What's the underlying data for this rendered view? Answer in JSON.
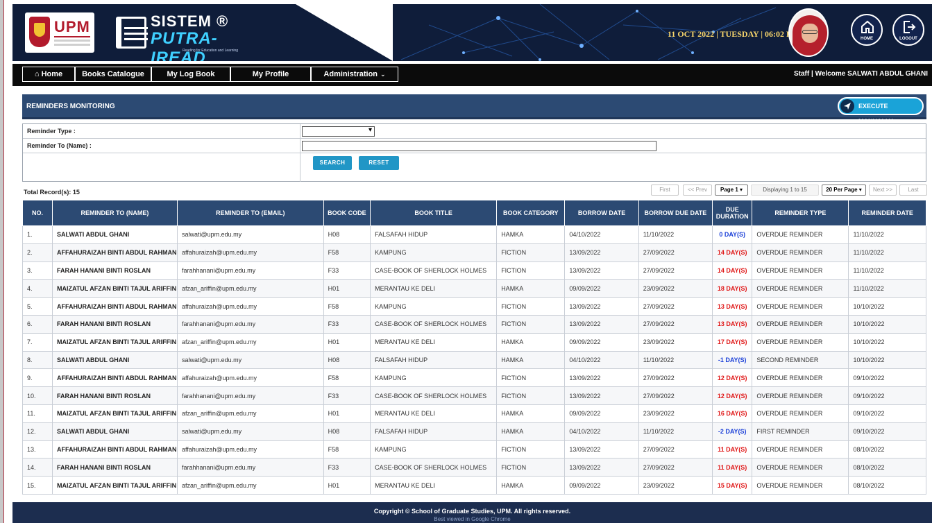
{
  "header": {
    "upm_logo_text": "UPM",
    "brand_line1": "SISTEM ®",
    "brand_line2": "PUTRA-IREAD",
    "brand_tagline": "Reading for Education and Learning",
    "datetime": "11 OCT 2022 | TUESDAY | 06:02 PM",
    "home_label": "HOME",
    "logout_label": "LOGOUT"
  },
  "nav": {
    "home": "Home",
    "books_catalogue": "Books Catalogue",
    "my_log_book": "My Log Book",
    "my_profile": "My Profile",
    "administration": "Administration",
    "welcome": "Staff | Welcome SALWATI ABDUL GHANI"
  },
  "panel": {
    "title": "REMINDERS MONITORING",
    "execute_label": "EXECUTE MANUALLY"
  },
  "filter": {
    "reminder_type_label": "Reminder Type :",
    "reminder_type_value": "",
    "reminder_to_label": "Reminder To (Name) :",
    "reminder_to_value": "",
    "search_label": "SEARCH",
    "reset_label": "RESET"
  },
  "pager": {
    "total": "Total Record(s): 15",
    "first": "First",
    "prev": "<< Prev",
    "page": "Page 1",
    "displaying": "Displaying 1 to 15",
    "per_page": "20 Per Page",
    "next": "Next >>",
    "last": "Last"
  },
  "table": {
    "columns": [
      "NO.",
      "REMINDER TO (NAME)",
      "REMINDER TO (EMAIL)",
      "BOOK CODE",
      "BOOK TITLE",
      "BOOK CATEGORY",
      "BORROW DATE",
      "BORROW DUE DATE",
      "DUE DURATION",
      "REMINDER TYPE",
      "REMINDER DATE"
    ],
    "rows": [
      [
        "1.",
        "SALWATI ABDUL GHANI",
        "salwati@upm.edu.my",
        "H08",
        "FALSAFAH HIDUP",
        "HAMKA",
        "04/10/2022",
        "11/10/2022",
        "0 DAY(S)",
        "OVERDUE REMINDER",
        "11/10/2022"
      ],
      [
        "2.",
        "AFFAHURAIZAH BINTI ABDUL RAHMAN",
        "affahuraizah@upm.edu.my",
        "F58",
        "KAMPUNG",
        "FICTION",
        "13/09/2022",
        "27/09/2022",
        "14 DAY(S)",
        "OVERDUE REMINDER",
        "11/10/2022"
      ],
      [
        "3.",
        "FARAH HANANI BINTI ROSLAN",
        "farahhanani@upm.edu.my",
        "F33",
        "CASE-BOOK OF SHERLOCK HOLMES",
        "FICTION",
        "13/09/2022",
        "27/09/2022",
        "14 DAY(S)",
        "OVERDUE REMINDER",
        "11/10/2022"
      ],
      [
        "4.",
        "MAIZATUL AFZAN BINTI TAJUL ARIFFIN",
        "afzan_ariffin@upm.edu.my",
        "H01",
        "MERANTAU KE DELI",
        "HAMKA",
        "09/09/2022",
        "23/09/2022",
        "18 DAY(S)",
        "OVERDUE REMINDER",
        "11/10/2022"
      ],
      [
        "5.",
        "AFFAHURAIZAH BINTI ABDUL RAHMAN",
        "affahuraizah@upm.edu.my",
        "F58",
        "KAMPUNG",
        "FICTION",
        "13/09/2022",
        "27/09/2022",
        "13 DAY(S)",
        "OVERDUE REMINDER",
        "10/10/2022"
      ],
      [
        "6.",
        "FARAH HANANI BINTI ROSLAN",
        "farahhanani@upm.edu.my",
        "F33",
        "CASE-BOOK OF SHERLOCK HOLMES",
        "FICTION",
        "13/09/2022",
        "27/09/2022",
        "13 DAY(S)",
        "OVERDUE REMINDER",
        "10/10/2022"
      ],
      [
        "7.",
        "MAIZATUL AFZAN BINTI TAJUL ARIFFIN",
        "afzan_ariffin@upm.edu.my",
        "H01",
        "MERANTAU KE DELI",
        "HAMKA",
        "09/09/2022",
        "23/09/2022",
        "17 DAY(S)",
        "OVERDUE REMINDER",
        "10/10/2022"
      ],
      [
        "8.",
        "SALWATI ABDUL GHANI",
        "salwati@upm.edu.my",
        "H08",
        "FALSAFAH HIDUP",
        "HAMKA",
        "04/10/2022",
        "11/10/2022",
        "-1 DAY(S)",
        "SECOND REMINDER",
        "10/10/2022"
      ],
      [
        "9.",
        "AFFAHURAIZAH BINTI ABDUL RAHMAN",
        "affahuraizah@upm.edu.my",
        "F58",
        "KAMPUNG",
        "FICTION",
        "13/09/2022",
        "27/09/2022",
        "12 DAY(S)",
        "OVERDUE REMINDER",
        "09/10/2022"
      ],
      [
        "10.",
        "FARAH HANANI BINTI ROSLAN",
        "farahhanani@upm.edu.my",
        "F33",
        "CASE-BOOK OF SHERLOCK HOLMES",
        "FICTION",
        "13/09/2022",
        "27/09/2022",
        "12 DAY(S)",
        "OVERDUE REMINDER",
        "09/10/2022"
      ],
      [
        "11.",
        "MAIZATUL AFZAN BINTI TAJUL ARIFFIN",
        "afzan_ariffin@upm.edu.my",
        "H01",
        "MERANTAU KE DELI",
        "HAMKA",
        "09/09/2022",
        "23/09/2022",
        "16 DAY(S)",
        "OVERDUE REMINDER",
        "09/10/2022"
      ],
      [
        "12.",
        "SALWATI ABDUL GHANI",
        "salwati@upm.edu.my",
        "H08",
        "FALSAFAH HIDUP",
        "HAMKA",
        "04/10/2022",
        "11/10/2022",
        "-2 DAY(S)",
        "FIRST REMINDER",
        "09/10/2022"
      ],
      [
        "13.",
        "AFFAHURAIZAH BINTI ABDUL RAHMAN",
        "affahuraizah@upm.edu.my",
        "F58",
        "KAMPUNG",
        "FICTION",
        "13/09/2022",
        "27/09/2022",
        "11 DAY(S)",
        "OVERDUE REMINDER",
        "08/10/2022"
      ],
      [
        "14.",
        "FARAH HANANI BINTI ROSLAN",
        "farahhanani@upm.edu.my",
        "F33",
        "CASE-BOOK OF SHERLOCK HOLMES",
        "FICTION",
        "13/09/2022",
        "27/09/2022",
        "11 DAY(S)",
        "OVERDUE REMINDER",
        "08/10/2022"
      ],
      [
        "15.",
        "MAIZATUL AFZAN BINTI TAJUL ARIFFIN",
        "afzan_ariffin@upm.edu.my",
        "H01",
        "MERANTAU KE DELI",
        "HAMKA",
        "09/09/2022",
        "23/09/2022",
        "15 DAY(S)",
        "OVERDUE REMINDER",
        "08/10/2022"
      ]
    ],
    "due_colors": [
      "blue",
      "red",
      "red",
      "red",
      "red",
      "red",
      "red",
      "blue",
      "red",
      "red",
      "red",
      "blue",
      "red",
      "red",
      "red"
    ]
  },
  "footer": {
    "copyright": "Copyright © School of Graduate Studies, UPM. All rights reserved.",
    "best_viewed": "Best viewed in Google Chrome"
  },
  "colors": {
    "header_bg": "#0f1d3a",
    "panel_blue": "#2c4a73",
    "accent_cyan": "#1aa3d8",
    "due_red": "#e01818",
    "due_blue": "#1a3fd8"
  }
}
